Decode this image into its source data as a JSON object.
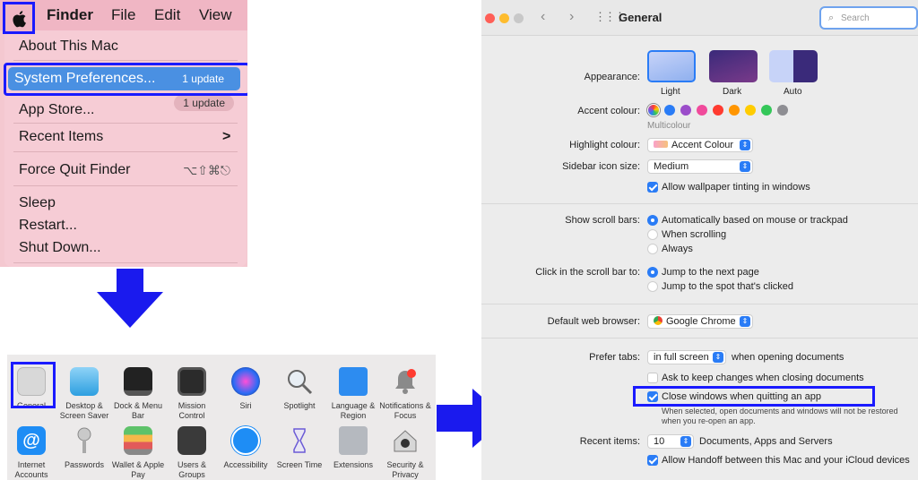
{
  "menubar": {
    "finder": "Finder",
    "file": "File",
    "edit": "Edit",
    "view": "View"
  },
  "apple_menu": {
    "about": "About This Mac",
    "system_prefs": "System Preferences...",
    "system_prefs_badge": "1 update",
    "app_store": "App Store...",
    "app_store_badge": "1 update",
    "recent_items": "Recent Items",
    "recent_items_arrow": ">",
    "force_quit": "Force Quit Finder",
    "force_quit_shortcut": "⌥⇧⌘⎋",
    "sleep": "Sleep",
    "restart": "Restart...",
    "shut_down": "Shut Down..."
  },
  "prefs_grid": {
    "row1": [
      "General",
      "Desktop & Screen Saver",
      "Dock & Menu Bar",
      "Mission Control",
      "Siri",
      "Spotlight",
      "Language & Region",
      "Notifications & Focus"
    ],
    "row2": [
      "Internet Accounts",
      "Passwords",
      "Wallet & Apple Pay",
      "Users & Groups",
      "Accessibility",
      "Screen Time",
      "Extensions",
      "Security & Privacy"
    ]
  },
  "general": {
    "title": "General",
    "search_placeholder": "Search",
    "appearance_label": "Appearance:",
    "appearance_options": [
      "Light",
      "Dark",
      "Auto"
    ],
    "accent_label": "Accent colour:",
    "accent_selected": "Multicolour",
    "accent_colors": [
      "#ff5f57",
      "#2a7cf6",
      "#9b4dca",
      "#f04a9b",
      "#ff3b30",
      "#ff9500",
      "#ffcc00",
      "#34c759",
      "#8e8e93"
    ],
    "highlight_label": "Highlight colour:",
    "highlight_value": "Accent Colour",
    "sidebar_label": "Sidebar icon size:",
    "sidebar_value": "Medium",
    "wallpaper_tint": "Allow wallpaper tinting in windows",
    "scroll_bars_label": "Show scroll bars:",
    "scroll_opt1": "Automatically based on mouse or trackpad",
    "scroll_opt2": "When scrolling",
    "scroll_opt3": "Always",
    "click_label": "Click in the scroll bar to:",
    "click_opt1": "Jump to the next page",
    "click_opt2": "Jump to the spot that's clicked",
    "browser_label": "Default web browser:",
    "browser_value": "Google Chrome",
    "tabs_label": "Prefer tabs:",
    "tabs_value": "in full screen",
    "tabs_suffix": "when opening documents",
    "ask_keep": "Ask to keep changes when closing documents",
    "close_windows": "Close windows when quitting an app",
    "close_note": "When selected, open documents and windows will not be restored when you re-open an app.",
    "recent_label": "Recent items:",
    "recent_value": "10",
    "recent_suffix": "Documents, Apps and Servers",
    "handoff": "Allow Handoff between this Mac and your iCloud devices"
  }
}
